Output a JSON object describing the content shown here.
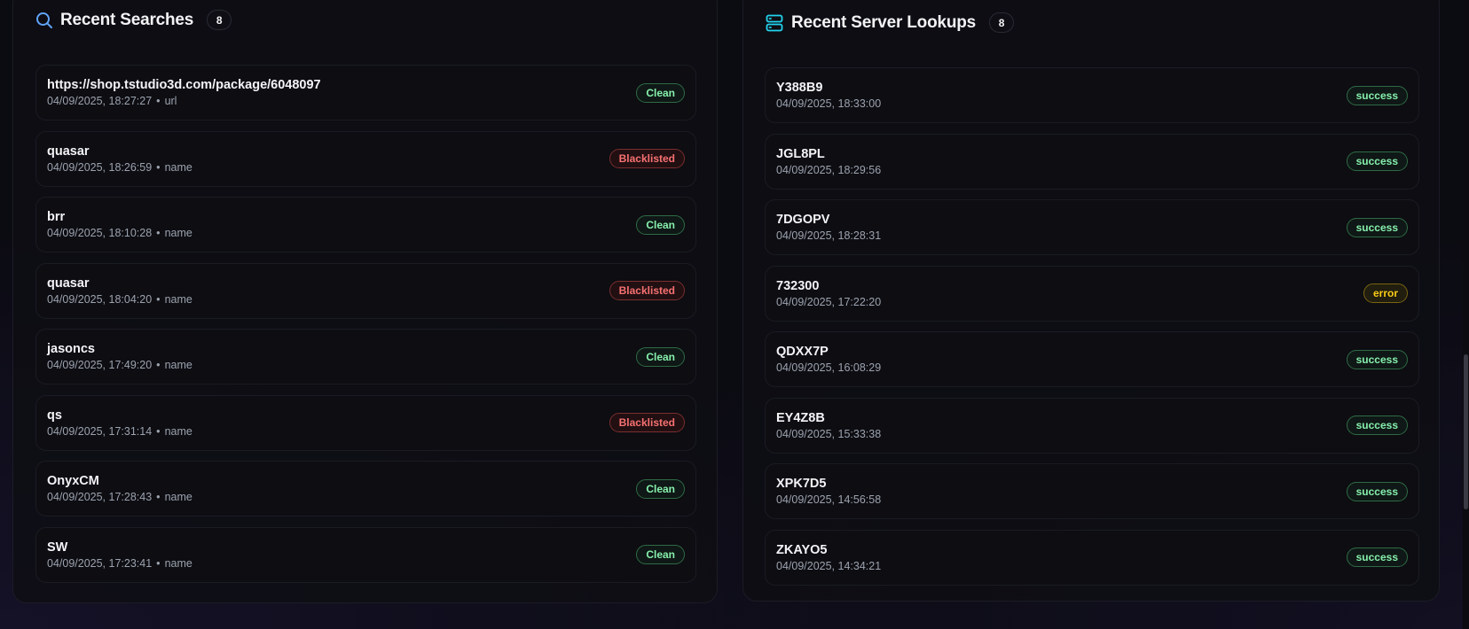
{
  "recent_searches": {
    "title": "Recent Searches",
    "count": "8",
    "icon": "search-icon",
    "items": [
      {
        "query": "https://shop.tstudio3d.com/package/6048097",
        "timestamp": "04/09/2025, 18:27:27",
        "type": "url",
        "status": "Clean"
      },
      {
        "query": "quasar",
        "timestamp": "04/09/2025, 18:26:59",
        "type": "name",
        "status": "Blacklisted"
      },
      {
        "query": "brr",
        "timestamp": "04/09/2025, 18:10:28",
        "type": "name",
        "status": "Clean"
      },
      {
        "query": "quasar",
        "timestamp": "04/09/2025, 18:04:20",
        "type": "name",
        "status": "Blacklisted"
      },
      {
        "query": "jasoncs",
        "timestamp": "04/09/2025, 17:49:20",
        "type": "name",
        "status": "Clean"
      },
      {
        "query": "qs",
        "timestamp": "04/09/2025, 17:31:14",
        "type": "name",
        "status": "Blacklisted"
      },
      {
        "query": "OnyxCM",
        "timestamp": "04/09/2025, 17:28:43",
        "type": "name",
        "status": "Clean"
      },
      {
        "query": "SW",
        "timestamp": "04/09/2025, 17:23:41",
        "type": "name",
        "status": "Clean"
      }
    ]
  },
  "recent_server_lookups": {
    "title": "Recent Server Lookups",
    "count": "8",
    "icon": "server-icon",
    "items": [
      {
        "code": "Y388B9",
        "timestamp": "04/09/2025, 18:33:00",
        "status": "success"
      },
      {
        "code": "JGL8PL",
        "timestamp": "04/09/2025, 18:29:56",
        "status": "success"
      },
      {
        "code": "7DGOPV",
        "timestamp": "04/09/2025, 18:28:31",
        "status": "success"
      },
      {
        "code": "732300",
        "timestamp": "04/09/2025, 17:22:20",
        "status": "error"
      },
      {
        "code": "QDXX7P",
        "timestamp": "04/09/2025, 16:08:29",
        "status": "success"
      },
      {
        "code": "EY4Z8B",
        "timestamp": "04/09/2025, 15:33:38",
        "status": "success"
      },
      {
        "code": "XPK7D5",
        "timestamp": "04/09/2025, 14:56:58",
        "status": "success"
      },
      {
        "code": "ZKAYO5",
        "timestamp": "04/09/2025, 14:34:21",
        "status": "success"
      }
    ]
  },
  "colors": {
    "search_icon": "#60a5fa",
    "server_icon": "#22d3ee",
    "clean": "#86efac",
    "blacklisted": "#f87171",
    "success": "#86efac",
    "error": "#facc15"
  }
}
